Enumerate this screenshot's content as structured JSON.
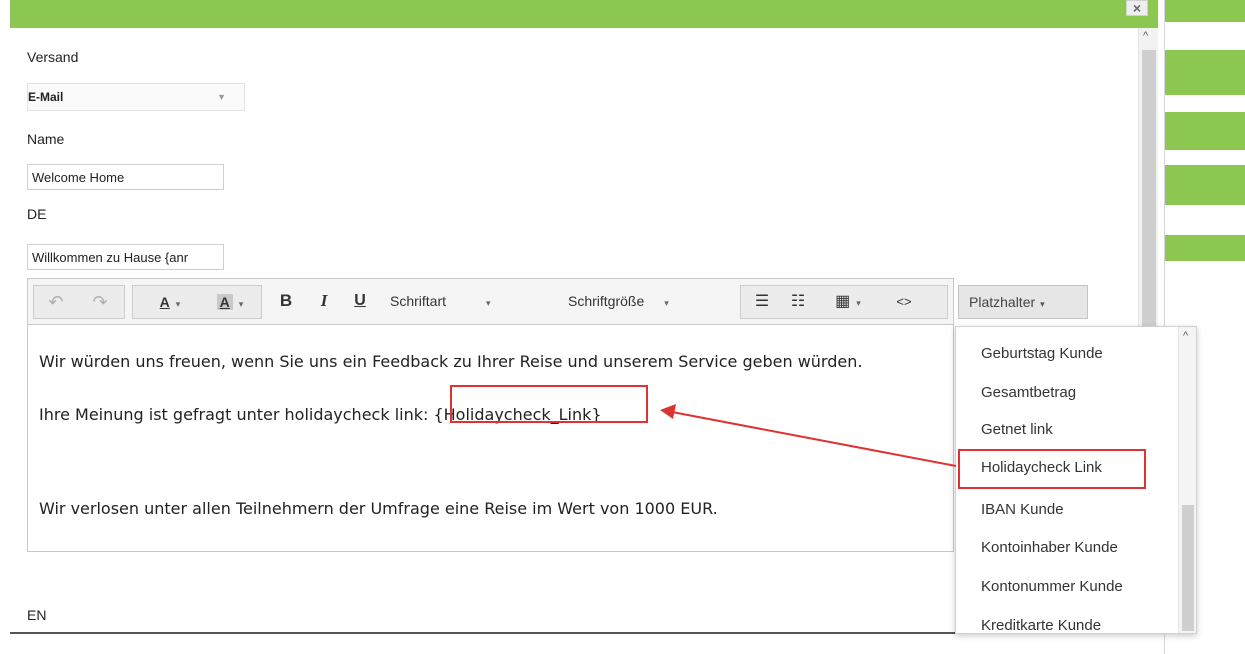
{
  "window": {
    "close_label": "×"
  },
  "form": {
    "versand_label": "Versand",
    "versand_value": "E-Mail",
    "name_label": "Name",
    "name_value": "Welcome Home",
    "de_label": "DE",
    "de_value": "Willkommen zu Hause {anr",
    "en_label": "EN"
  },
  "toolbar": {
    "undo_icon": "↶",
    "redo_icon": "↷",
    "text_color_label": "A",
    "bg_color_label": "A",
    "bold_label": "B",
    "italic_label": "I",
    "underline_label": "U",
    "font_label": "Schriftart",
    "font_size_label": "Schriftgröße",
    "bullet_list_icon": "☰",
    "numbered_list_icon": "☷",
    "table_icon": "▦",
    "code_icon": "<>",
    "dropdown_caret": "▾",
    "placeholder_label": "Platzhalter",
    "placeholder_caret": "▾"
  },
  "editor": {
    "line1": "Wir würden uns freuen, wenn Sie uns ein Feedback zu Ihrer Reise und unserem Service geben würden.",
    "line2_prefix": "Ihre Meinung ist gefragt unter holidaycheck link: ",
    "line2_placeholder": "{Holidaycheck_Link}",
    "line3": "Wir verlosen unter allen Teilnehmern der Umfrage eine Reise im Wert von 1000 EUR."
  },
  "placeholder_menu": {
    "items": [
      "Geburtstag Kunde",
      "Gesamtbetrag",
      "Getnet link",
      "Holidaycheck Link",
      "IBAN Kunde",
      "Kontoinhaber Kunde",
      "Kontonummer Kunde",
      "Kreditkarte Kunde"
    ],
    "selected_index": 3
  },
  "colors": {
    "header_green": "#8cc751",
    "annotation_red": "#dd3333"
  },
  "icons": {
    "scroll_up": "^",
    "select_caret": "▼"
  }
}
